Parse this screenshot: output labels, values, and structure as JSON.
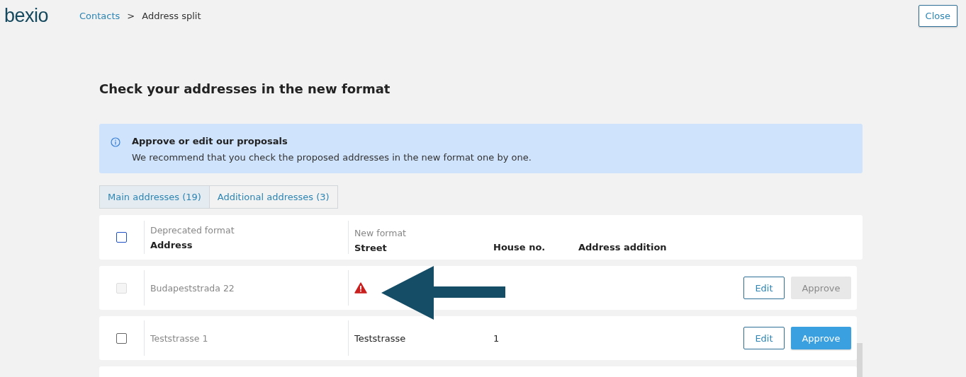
{
  "header": {
    "logo": "bexio",
    "breadcrumb": [
      {
        "label": "Contacts",
        "link": true
      },
      {
        "label": ">",
        "link": false
      },
      {
        "label": "Address split",
        "link": false
      }
    ],
    "close_button": "Close"
  },
  "title": "Check your addresses in the new format",
  "info": {
    "heading": "Approve or edit our proposals",
    "text": "We recommend that you check the proposed addresses in the new format one by one."
  },
  "tabs": [
    {
      "label": "Main addresses (19)",
      "selected": true
    },
    {
      "label": "Additional addresses (3)",
      "selected": false
    }
  ],
  "table": {
    "select_all_checked": false,
    "group_deprecated": "Deprecated format",
    "group_new": "New format",
    "columns": [
      "Address",
      "Street",
      "House no.",
      "Address addition"
    ],
    "rows": [
      {
        "address": "Budapeststrada 22",
        "checked": false,
        "disabled": true,
        "warning": true,
        "edit": "Edit",
        "approve": "Approve",
        "approve_disabled": true
      },
      {
        "address": "Teststrasse 1",
        "street": "Teststrasse",
        "house_no": "1",
        "checked": false,
        "disabled": false,
        "warning": false,
        "edit": "Edit",
        "approve": "Approve",
        "approve_disabled": false
      }
    ]
  }
}
